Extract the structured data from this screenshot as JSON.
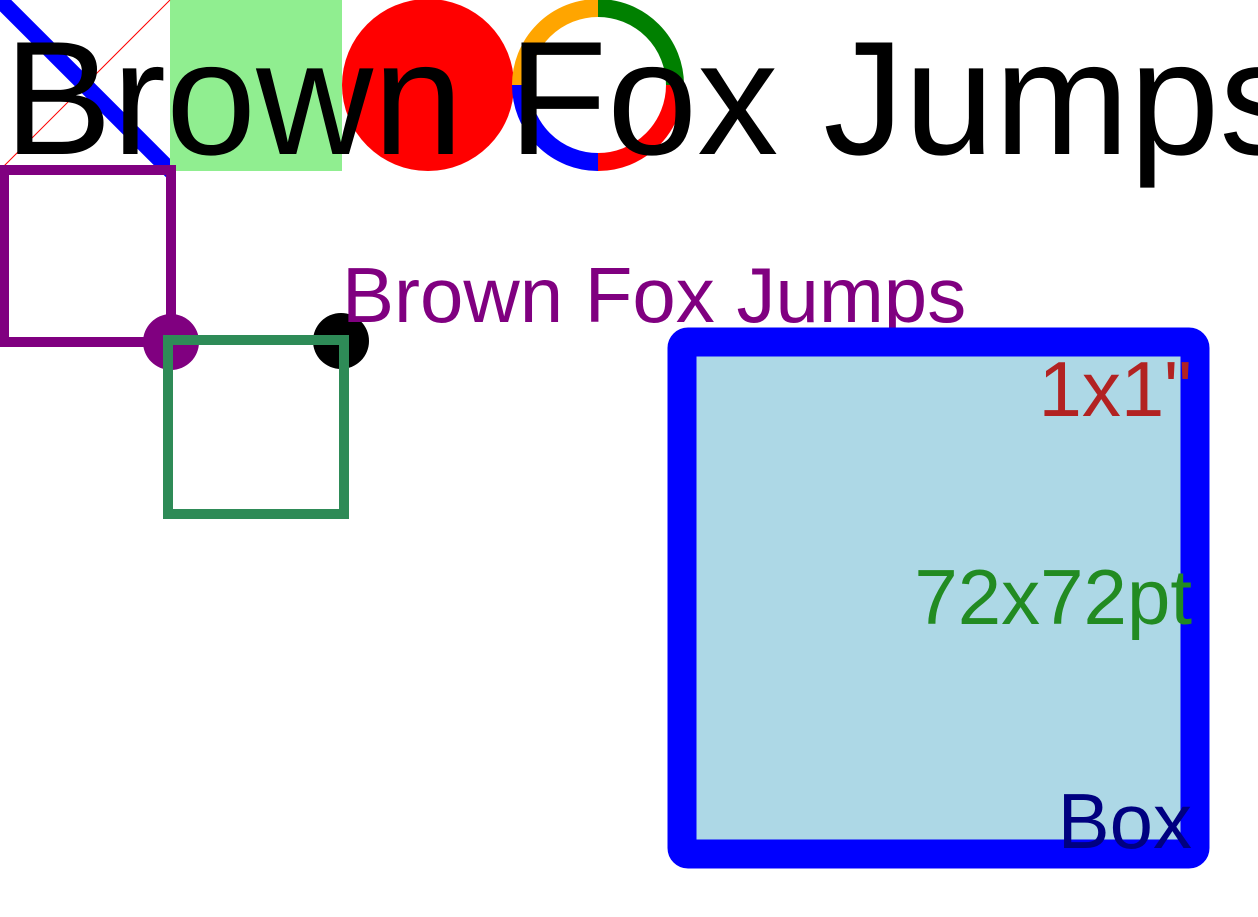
{
  "texts": {
    "big_heading": "Brown Fox Jumps",
    "purple_heading": "Brown Fox Jumps",
    "size_inch": "1x1\"",
    "size_pt": "72x72pt",
    "box_label": "Box"
  },
  "colors": {
    "background": "#ffffff",
    "big_heading": "#000000",
    "purple_heading": "#800080",
    "size_inch": "#b22222",
    "size_pt": "#228b22",
    "box_label": "#000080",
    "box_fill": "#add8e6",
    "box_border": "#0000ff",
    "diagonal_thick": "#0000ff",
    "diagonal_thin": "#ff0000",
    "light_green_rect": "#90ee90",
    "red_circle": "#ff0000",
    "ring_top_left": "#ffa500",
    "ring_top_right": "#008000",
    "ring_bottom_right": "#ff0000",
    "ring_bottom_left": "#0000ff",
    "purple_square": "#800080",
    "purple_dot": "#800080",
    "green_square": "#2e8b57",
    "black_dot": "#000000"
  }
}
